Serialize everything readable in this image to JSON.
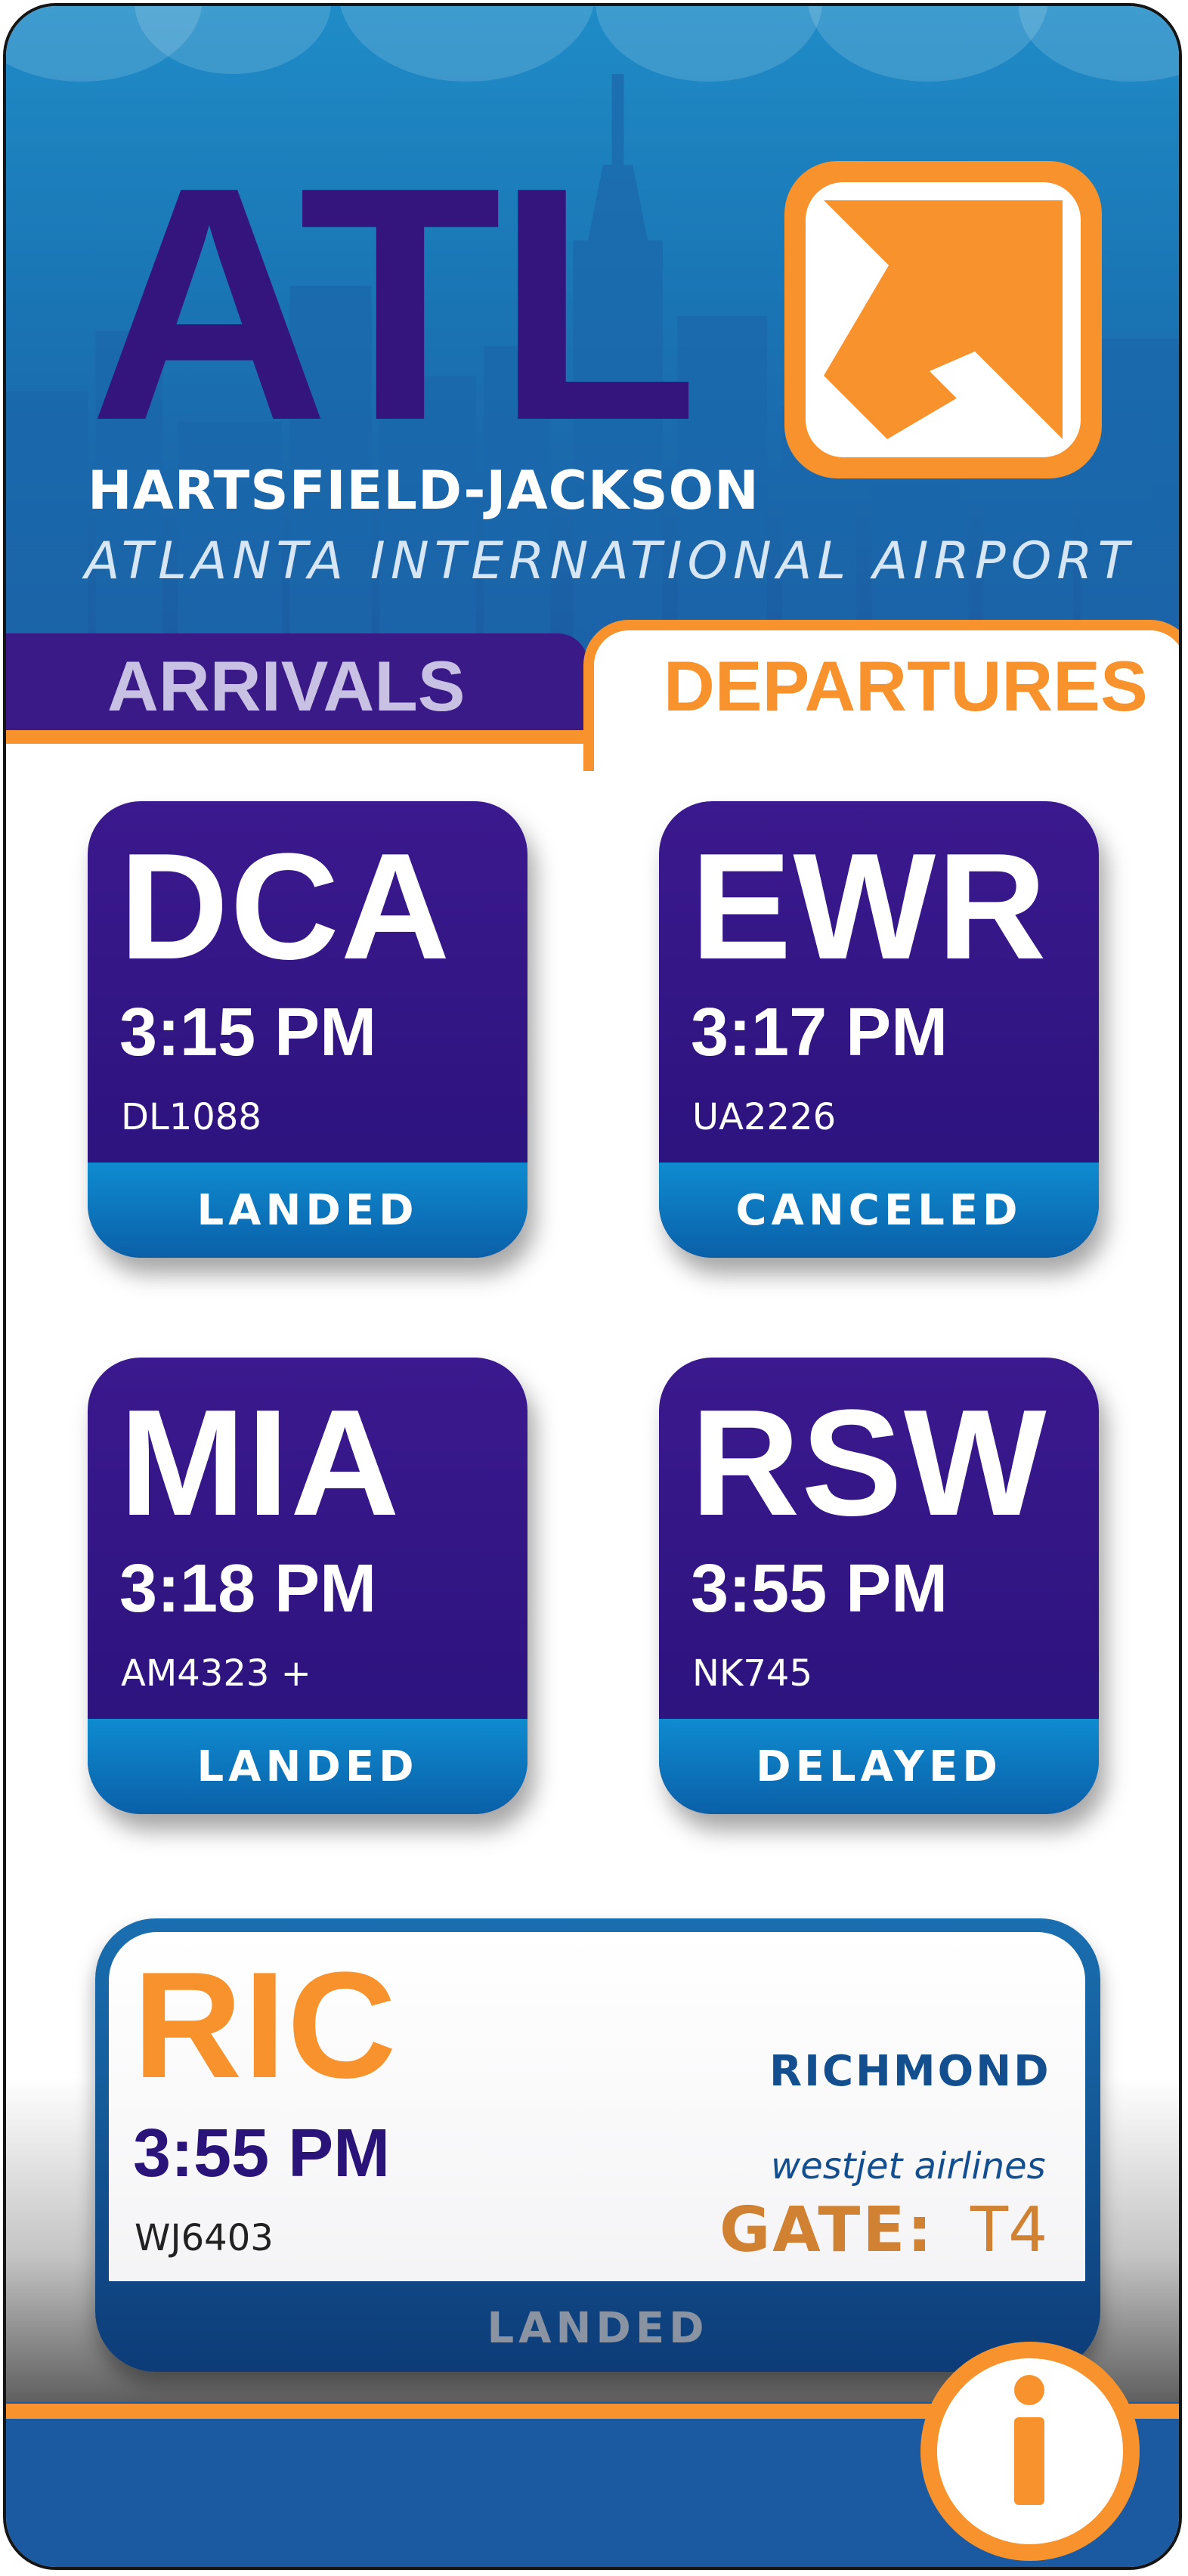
{
  "header": {
    "brand_code": "ATL",
    "title_line1": "HARTSFIELD-JACKSON",
    "title_line2": "ATLANTA INTERNATIONAL AIRPORT",
    "logo_icon": "arrow-up-right-icon",
    "colors": {
      "brand_orange": "#f7922c",
      "brand_purple": "#34157d",
      "sky_blue": "#1a74b4"
    }
  },
  "tabs": [
    {
      "label": "ARRIVALS",
      "active": false
    },
    {
      "label": "DEPARTURES",
      "active": true
    }
  ],
  "flights": [
    {
      "code": "DCA",
      "time": "3:15 PM",
      "flight": "DL1088",
      "status": "LANDED"
    },
    {
      "code": "EWR",
      "time": "3:17 PM",
      "flight": "UA2226",
      "status": "CANCELED"
    },
    {
      "code": "MIA",
      "time": "3:18 PM",
      "flight": "AM4323 +",
      "status": "LANDED"
    },
    {
      "code": "RSW",
      "time": "3:55 PM",
      "flight": "NK745",
      "status": "DELAYED"
    }
  ],
  "featured": {
    "code": "RIC",
    "city": "RICHMOND",
    "time": "3:55 PM",
    "airline": "westjet airlines",
    "flight": "WJ6403",
    "gate_label": "GATE:",
    "gate": "T4",
    "status": "LANDED"
  },
  "info_button": {
    "icon": "info-icon"
  }
}
